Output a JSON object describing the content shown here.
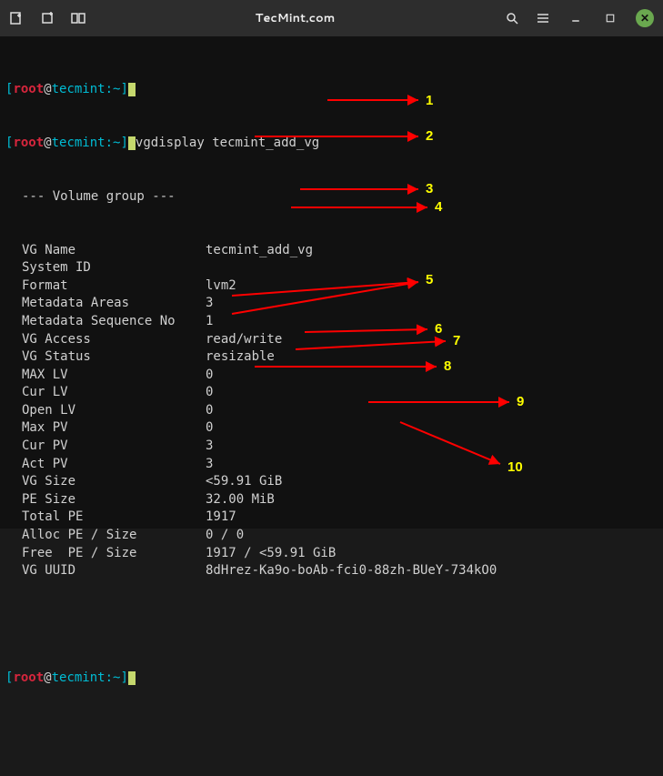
{
  "title": "TecMint.com",
  "prompt": {
    "user": "root",
    "host": "tecmint",
    "path": "~"
  },
  "command": "vgdisplay tecmint_add_vg",
  "group_header": "--- Volume group ---",
  "fields": [
    {
      "label": "VG Name",
      "value": "tecmint_add_vg"
    },
    {
      "label": "System ID",
      "value": ""
    },
    {
      "label": "Format",
      "value": "lvm2"
    },
    {
      "label": "Metadata Areas",
      "value": "3"
    },
    {
      "label": "Metadata Sequence No",
      "value": "1"
    },
    {
      "label": "VG Access",
      "value": "read/write"
    },
    {
      "label": "VG Status",
      "value": "resizable"
    },
    {
      "label": "MAX LV",
      "value": "0"
    },
    {
      "label": "Cur LV",
      "value": "0"
    },
    {
      "label": "Open LV",
      "value": "0"
    },
    {
      "label": "Max PV",
      "value": "0"
    },
    {
      "label": "Cur PV",
      "value": "3"
    },
    {
      "label": "Act PV",
      "value": "3"
    },
    {
      "label": "VG Size",
      "value": "<59.91 GiB"
    },
    {
      "label": "PE Size",
      "value": "32.00 MiB"
    },
    {
      "label": "Total PE",
      "value": "1917"
    },
    {
      "label": "Alloc PE / Size",
      "value": "0 / 0"
    },
    {
      "label": "Free  PE / Size",
      "value": "1917 / <59.91 GiB"
    },
    {
      "label": "VG UUID",
      "value": "8dHrez-Ka9o-boAb-fci0-88zh-BUeY-734kO0"
    }
  ],
  "annotations": [
    "1",
    "2",
    "3",
    "4",
    "5",
    "6",
    "7",
    "8",
    "9",
    "10"
  ]
}
